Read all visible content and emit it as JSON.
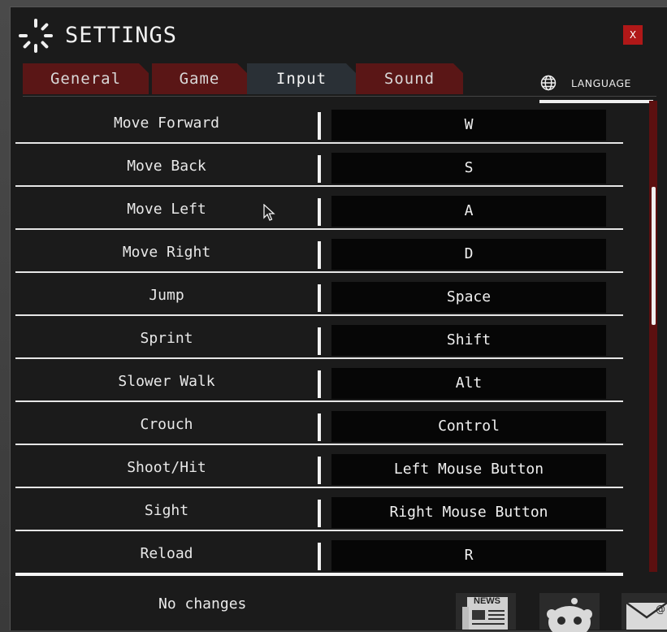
{
  "window": {
    "title": "SETTINGS",
    "close_label": "X"
  },
  "tabs": [
    {
      "label": "General",
      "active": false
    },
    {
      "label": "Game",
      "active": false
    },
    {
      "label": "Input",
      "active": true
    },
    {
      "label": "Sound",
      "active": false
    }
  ],
  "language": {
    "label": "LANGUAGE",
    "icon": "globe-icon"
  },
  "keybindings": [
    {
      "action": "Move Forward",
      "key": "W"
    },
    {
      "action": "Move Back",
      "key": "S"
    },
    {
      "action": "Move Left",
      "key": "A"
    },
    {
      "action": "Move Right",
      "key": "D"
    },
    {
      "action": "Jump",
      "key": "Space"
    },
    {
      "action": "Sprint",
      "key": "Shift"
    },
    {
      "action": "Slower Walk",
      "key": "Alt"
    },
    {
      "action": "Crouch",
      "key": "Control"
    },
    {
      "action": "Shoot/Hit",
      "key": "Left Mouse Button"
    },
    {
      "action": "Sight",
      "key": "Right Mouse Button"
    },
    {
      "action": "Reload",
      "key": "R"
    }
  ],
  "status": {
    "text": "No changes"
  },
  "social": {
    "news_label": "NEWS",
    "icons": [
      "news-icon",
      "reddit-icon",
      "mail-icon"
    ]
  },
  "colors": {
    "accent": "#5a1616",
    "active_tab": "#2a3036",
    "close": "#b01818",
    "background": "#1b1b1b"
  }
}
